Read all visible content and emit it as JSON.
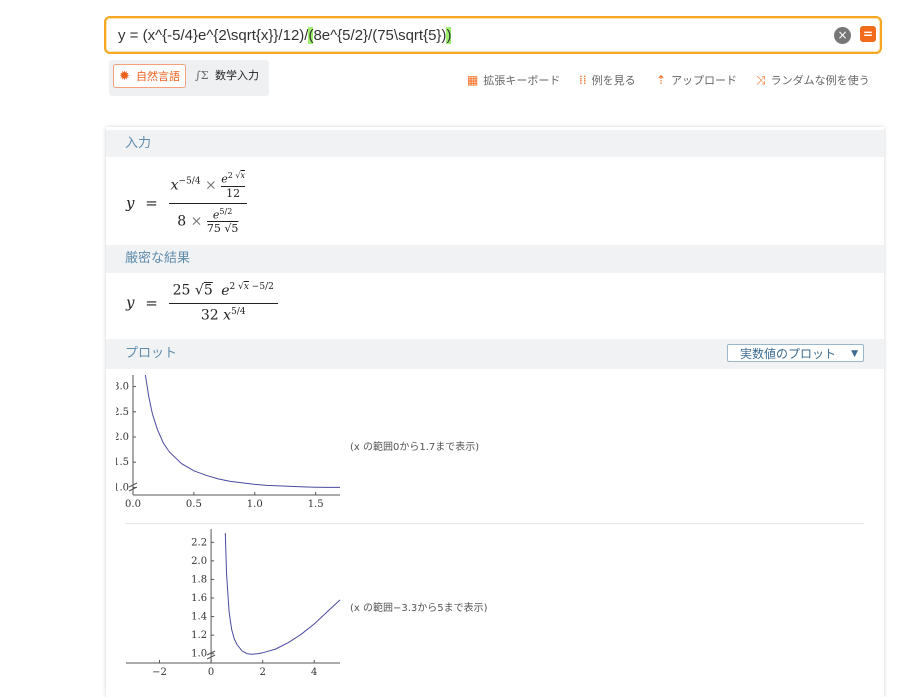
{
  "search": {
    "query_before": "y = (x^{-5/4}e^{2\\sqrt{x}}/12)/",
    "query_hl_open": "(",
    "query_middle": "8e^{5/2}/(75\\sqrt{5})",
    "query_hl_close": ")",
    "clear_icon": "×",
    "go_icon": "="
  },
  "modes": {
    "natural_label": "自然言語",
    "math_label": "数学入力",
    "natural_icon": "✹",
    "math_icon": "∫Σ"
  },
  "tools": [
    {
      "label": "拡張キーボード",
      "icon": "keyboard-icon"
    },
    {
      "label": "例を見る",
      "icon": "examples-icon"
    },
    {
      "label": "アップロード",
      "icon": "upload-icon"
    },
    {
      "label": "ランダムな例を使う",
      "icon": "random-icon"
    }
  ],
  "pods": {
    "input_title": "入力",
    "exact_title": "厳密な結果",
    "plot_title": "プロット",
    "plot_select": "実数値のプロット"
  },
  "formula_input": {
    "lhs": "y",
    "eq": "=",
    "x": "x",
    "x_exp": "−5/4",
    "times": "×",
    "e": "e",
    "e_exp_2": "2",
    "sqrt": "√",
    "e_exp_x": "x",
    "den12": "12",
    "eight": "8",
    "e52": "5/2",
    "den75": "75",
    "five": "5"
  },
  "formula_exact": {
    "lhs": "y",
    "eq": "=",
    "c25": "25",
    "sqrt": "√",
    "five": "5",
    "e": "e",
    "exp_2": "2",
    "exp_x": "x",
    "exp_tail": " −5/2",
    "c32": "32",
    "x": "x",
    "x_exp": "5/4"
  },
  "chart_data": [
    {
      "type": "line",
      "title": "",
      "xlabel": "",
      "ylabel": "",
      "xlim": [
        0,
        1.7
      ],
      "ylim": [
        0.85,
        3.15
      ],
      "x_ticks": [
        "0.0",
        "0.5",
        "1.0",
        "1.5"
      ],
      "y_ticks": [
        "1.0",
        "1.5",
        "2.0",
        "2.5",
        "3.0"
      ],
      "series": [
        {
          "x": [
            0.1,
            0.13,
            0.16,
            0.2,
            0.25,
            0.3,
            0.4,
            0.5,
            0.6,
            0.7,
            0.8,
            0.9,
            1.0,
            1.1,
            1.2,
            1.3,
            1.4,
            1.5,
            1.6,
            1.7
          ],
          "y": [
            3.25,
            2.8,
            2.45,
            2.15,
            1.88,
            1.7,
            1.47,
            1.33,
            1.24,
            1.17,
            1.12,
            1.09,
            1.06,
            1.04,
            1.03,
            1.02,
            1.01,
            1.005,
            1.0,
            1.0
          ]
        }
      ],
      "color": "#4a4aa0",
      "range_note": "(x の範囲0から1.7まで表示)"
    },
    {
      "type": "line",
      "title": "",
      "xlabel": "",
      "ylabel": "",
      "xlim": [
        -3.3,
        5
      ],
      "ylim": [
        0.9,
        2.3
      ],
      "x_ticks": [
        "−2",
        "0",
        "2",
        "4"
      ],
      "y_ticks": [
        "1.0",
        "1.2",
        "1.4",
        "1.6",
        "1.8",
        "2.0",
        "2.2"
      ],
      "series": [
        {
          "x": [
            0.55,
            0.6,
            0.7,
            0.8,
            0.9,
            1.0,
            1.2,
            1.4,
            1.6,
            1.8,
            2.0,
            2.5,
            3.0,
            3.5,
            4.0,
            4.5,
            5.0
          ],
          "y": [
            2.3,
            1.85,
            1.45,
            1.26,
            1.16,
            1.1,
            1.03,
            1.0,
            0.995,
            1.0,
            1.01,
            1.05,
            1.12,
            1.21,
            1.32,
            1.45,
            1.58
          ]
        }
      ],
      "color": "#4a4aa0",
      "range_note": "(x の範囲−3.3から5まで表示)"
    }
  ]
}
